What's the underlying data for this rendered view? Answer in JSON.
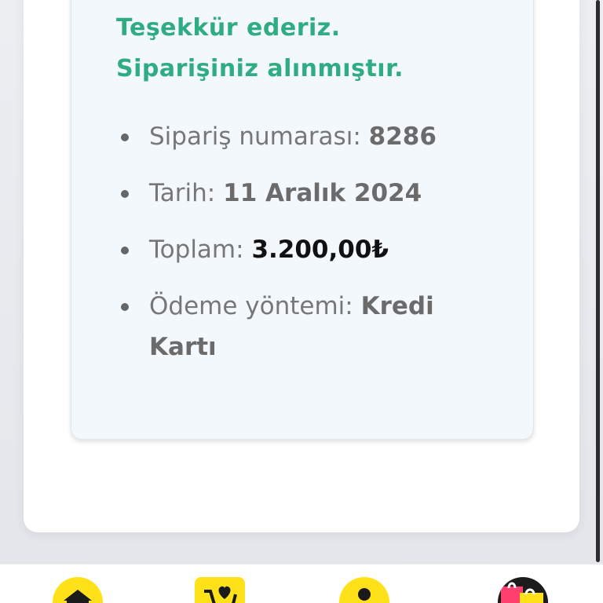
{
  "confirmation": {
    "line1": "Teşekkür ederiz.",
    "line2": "Siparişiniz alınmıştır."
  },
  "order": {
    "number_label": "Sipariş numarası:",
    "number_value": "8286",
    "date_label": "Tarih:",
    "date_value": "11 Aralık 2024",
    "total_label": "Toplam:",
    "total_value": "3.200,00₺",
    "payment_label": "Ödeme yöntemi:",
    "payment_value": "Kredi Kartı"
  },
  "bottom_nav": {
    "items": [
      {
        "icon": "home-icon"
      },
      {
        "icon": "cart-heart-icon"
      },
      {
        "icon": "profile-icon"
      },
      {
        "icon": "shopping-bag-icon"
      }
    ]
  },
  "colors": {
    "accent_green": "#2fac82",
    "nav_yellow": "#ffe11a"
  }
}
